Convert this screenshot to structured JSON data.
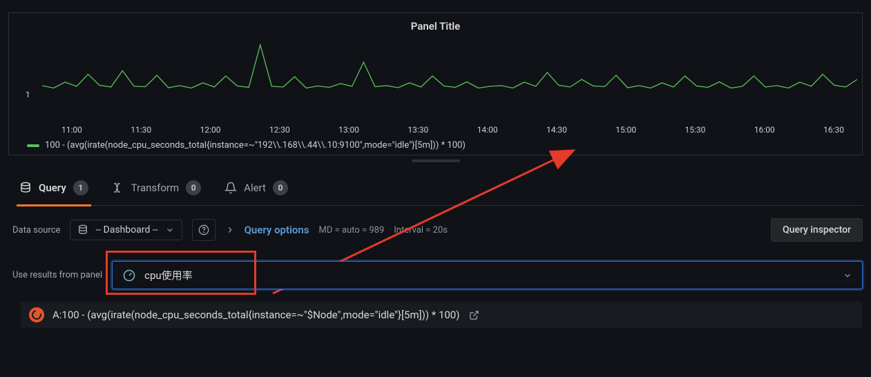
{
  "panel": {
    "title": "Panel Title",
    "y_label": "1",
    "legend_text": "100 - (avg(irate(node_cpu_seconds_total{instance=~\"192\\\\.168\\\\.44\\\\.10:9100\",mode=\"idle\"}[5m])) * 100)"
  },
  "tabs": {
    "query_label": "Query",
    "query_count": "1",
    "transform_label": "Transform",
    "transform_count": "0",
    "alert_label": "Alert",
    "alert_count": "0"
  },
  "datasource": {
    "label": "Data source",
    "selected": "-- Dashboard --"
  },
  "query_options": {
    "label": "Query options",
    "md_text": "MD = auto = 989",
    "interval_text": "Interval = 20s"
  },
  "inspector_button": "Query inspector",
  "use_results": {
    "label": "Use results from panel",
    "selected": "cpu使用率"
  },
  "resultA": {
    "text": "A:100 - (avg(irate(node_cpu_seconds_total{instance=~\"$Node\",mode=\"idle\"}[5m])) * 100)"
  },
  "chart_data": {
    "type": "line",
    "title": "Panel Title",
    "xlabel": "",
    "ylabel": "",
    "ylim": [
      0,
      2
    ],
    "x_ticks": [
      "11:00",
      "11:30",
      "12:00",
      "12:30",
      "13:00",
      "13:30",
      "14:00",
      "14:30",
      "15:00",
      "15:30",
      "16:00",
      "16:30"
    ],
    "series": [
      {
        "name": "100 - (avg(irate(node_cpu_seconds_total{instance=~\"192\\\\.168\\\\.44\\\\.10:9100\",mode=\"idle\"}[5m])) * 100)",
        "color": "#5ac25a",
        "values": [
          0.62,
          0.55,
          0.72,
          0.6,
          0.95,
          0.63,
          0.58,
          1.05,
          0.6,
          0.59,
          0.92,
          0.56,
          0.62,
          0.55,
          0.7,
          0.58,
          0.9,
          0.61,
          0.57,
          1.8,
          0.6,
          0.58,
          0.88,
          0.55,
          0.61,
          0.57,
          0.68,
          0.6,
          1.3,
          0.59,
          0.62,
          0.56,
          0.7,
          0.58,
          0.9,
          0.61,
          0.57,
          0.73,
          0.55,
          0.6,
          0.62,
          0.55,
          0.72,
          0.6,
          1.0,
          0.63,
          0.58,
          0.8,
          0.61,
          0.59,
          0.92,
          0.56,
          0.62,
          0.55,
          0.7,
          0.58,
          0.9,
          0.61,
          0.57,
          0.73,
          0.55,
          0.6,
          0.9,
          0.58,
          0.62,
          0.55,
          0.72,
          0.6,
          0.95,
          0.63,
          0.58,
          0.8
        ]
      }
    ]
  }
}
